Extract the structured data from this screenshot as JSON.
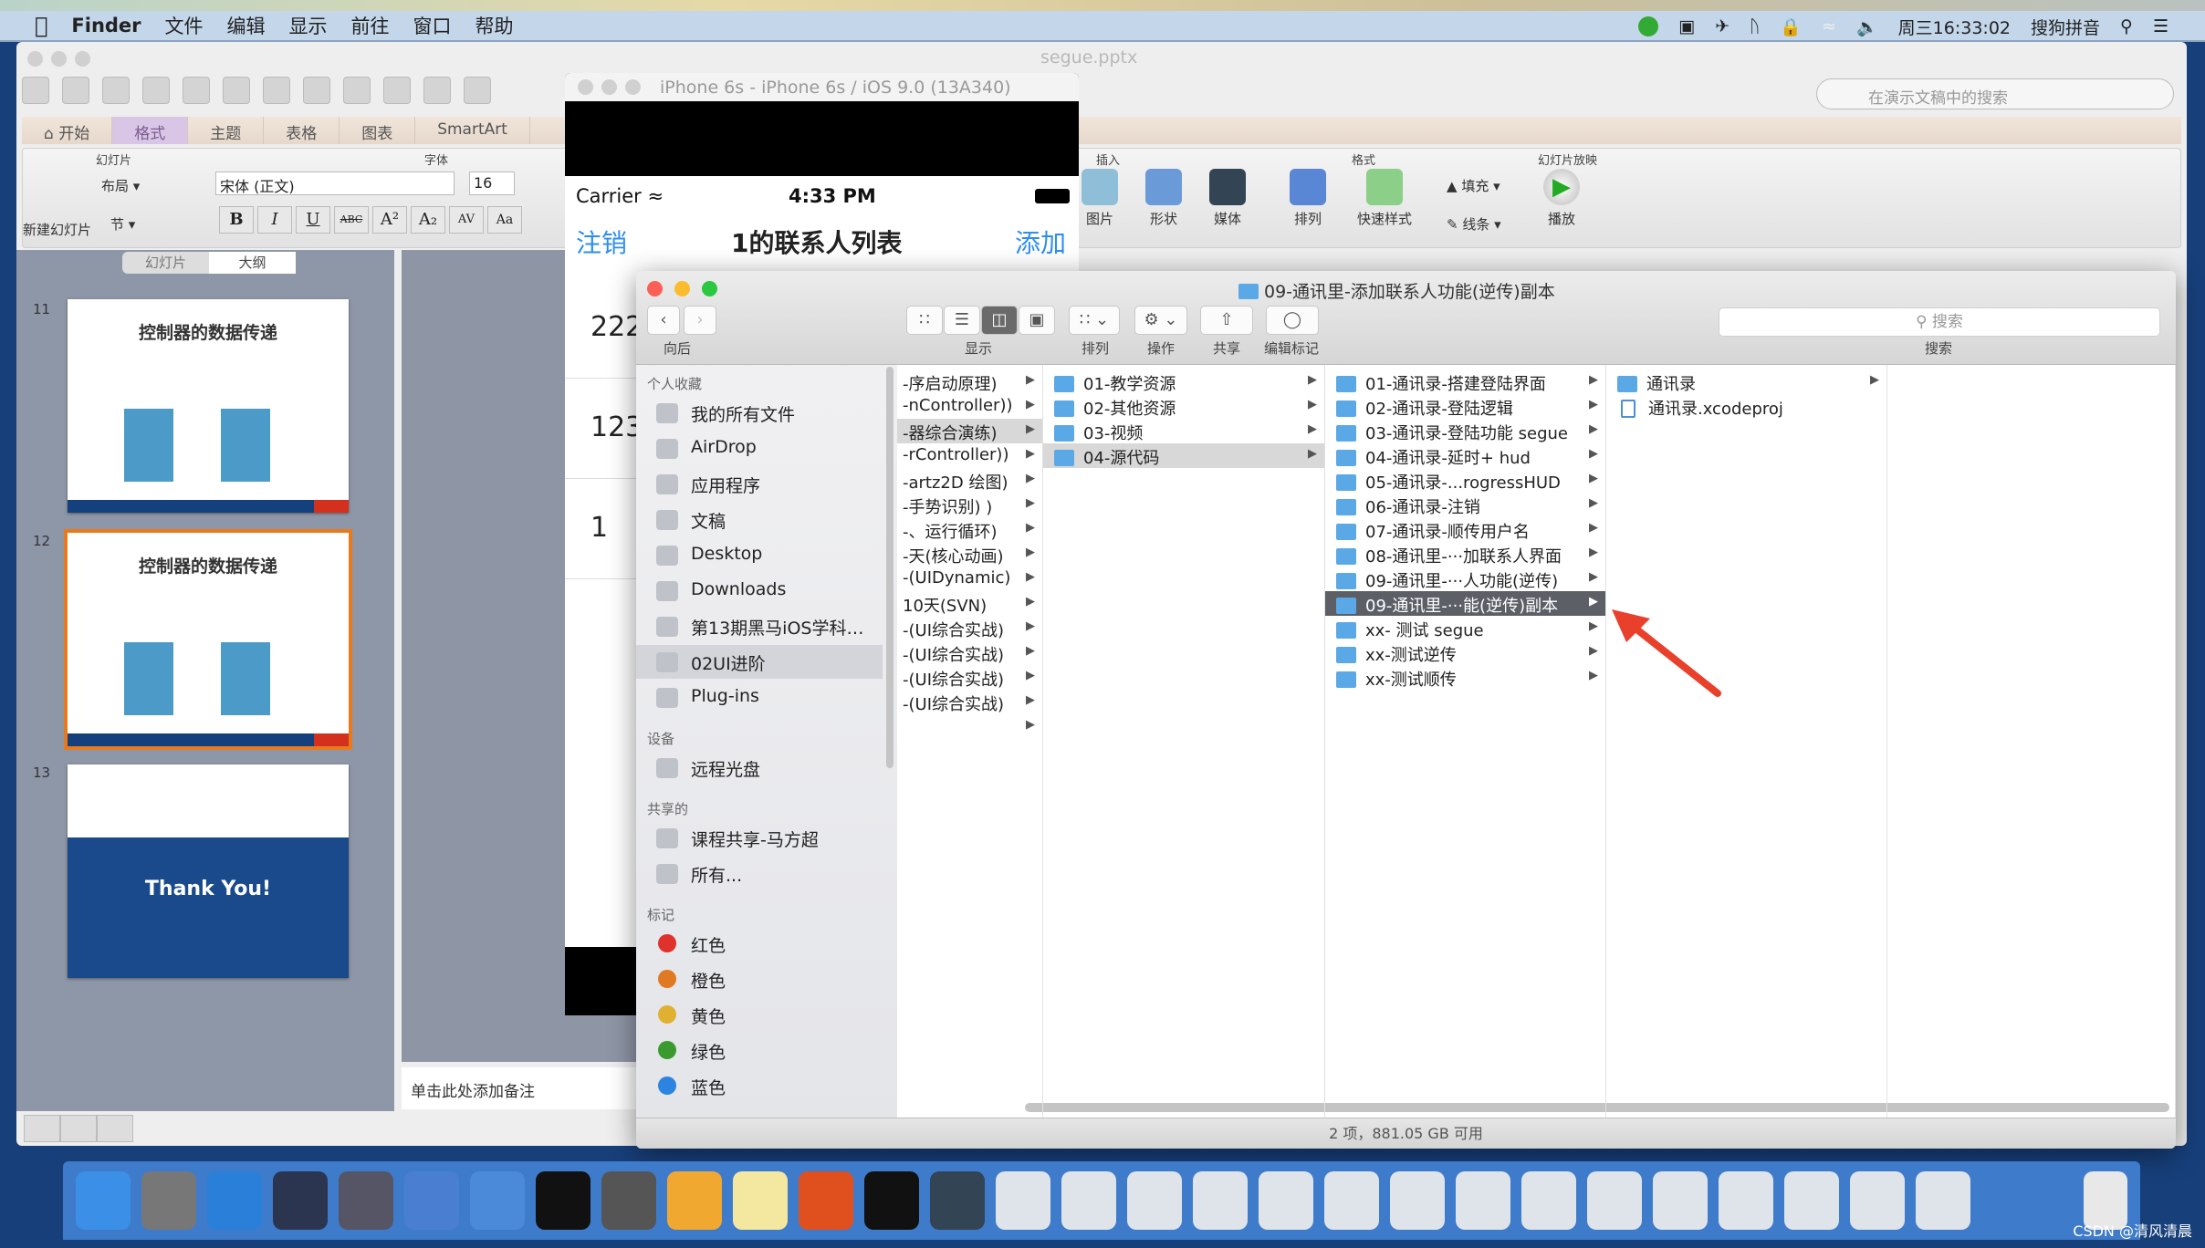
{
  "menubar": {
    "app": "Finder",
    "items": [
      "文件",
      "编辑",
      "显示",
      "前往",
      "窗口",
      "帮助"
    ],
    "clock": "周三16:33:02",
    "input_method": "搜狗拼音"
  },
  "ppt": {
    "title": "segue.pptx",
    "search_placeholder": "在演示文稿中的搜索",
    "tabs": [
      "开始",
      "格式",
      "主题",
      "表格",
      "图表",
      "SmartArt"
    ],
    "active_tab": "格式",
    "groups": {
      "slides": "幻灯片",
      "font": "字体",
      "insert": "插入",
      "format": "格式",
      "slideshow": "幻灯片放映"
    },
    "buttons": {
      "new_slide": "新建幻灯片",
      "layout": "布局",
      "section": "节",
      "picture": "图片",
      "shape": "形状",
      "media": "媒体",
      "arrange": "排列",
      "quick_style": "快速样式",
      "fill": "填充",
      "line": "线条",
      "play": "播放"
    },
    "font_name": "宋体 (正文)",
    "font_size": "16",
    "format_buttons": [
      "B",
      "I",
      "U",
      "ABC",
      "A²",
      "A₂",
      "AV",
      "Aa"
    ],
    "panel_tabs": [
      "幻灯片",
      "大纲"
    ],
    "slides": [
      {
        "num": "11",
        "title": "控制器的数据传递"
      },
      {
        "num": "12",
        "title": "控制器的数据传递",
        "selected": true
      },
      {
        "num": "13",
        "title": "Thank You!"
      }
    ],
    "notes_placeholder": "单击此处添加备注"
  },
  "simulator": {
    "title": "iPhone 6s - iPhone 6s / iOS 9.0 (13A340)",
    "carrier": "Carrier",
    "time": "4:33 PM",
    "nav_left": "注销",
    "nav_title": "1的联系人列表",
    "nav_right": "添加",
    "rows": [
      "222",
      "123",
      "1"
    ]
  },
  "finder": {
    "title": "09-通讯里-添加联系人功能(逆传)副本",
    "toolbar": {
      "back": "向后",
      "view": "显示",
      "arrange": "排列",
      "action": "操作",
      "share": "共享",
      "tags": "编辑标记",
      "search": "搜索",
      "search_placeholder": "搜索"
    },
    "sidebar": [
      {
        "heading": "个人收藏",
        "items": [
          "我的所有文件",
          "AirDrop",
          "应用程序",
          "文稿",
          "Desktop",
          "Downloads",
          "第13期黑马iOS学科…",
          "02UI进阶",
          "Plug-ins"
        ],
        "selected": "02UI进阶"
      },
      {
        "heading": "设备",
        "items": [
          "远程光盘"
        ]
      },
      {
        "heading": "共享的",
        "items": [
          "课程共享-马方超",
          "所有..."
        ]
      },
      {
        "heading": "标记",
        "items": [
          "红色",
          "橙色",
          "黄色",
          "绿色",
          "蓝色"
        ],
        "colors": [
          "#e0322c",
          "#e07a22",
          "#e0b030",
          "#3a9a2e",
          "#2c84e0"
        ]
      }
    ],
    "columns": [
      {
        "items": [
          "-序启动原理)",
          "-nController))",
          "-器综合演练)",
          "-rController))",
          "-artz2D 绘图)",
          "-手势识别) )",
          "-、运行循环)",
          "-天(核心动画)",
          "-(UIDynamic)",
          "10天(SVN)",
          "-(UI综合实战)",
          "-(UI综合实战)",
          "-(UI综合实战)",
          "-(UI综合实战)",
          ""
        ],
        "highlight": 2
      },
      {
        "items": [
          "01-教学资源",
          "02-其他资源",
          "03-视频",
          "04-源代码"
        ],
        "highlight": 3
      },
      {
        "items": [
          "01-通讯录-搭建登陆界面",
          "02-通讯录-登陆逻辑",
          "03-通讯录-登陆功能 segue",
          "04-通讯录-延时+ hud",
          "05-通讯录-...rogressHUD",
          "06-通讯录-注销",
          "07-通讯录-顺传用户名",
          "08-通讯里-···加联系人界面",
          "09-通讯里-···人功能(逆传)",
          "09-通讯里-···能(逆传)副本",
          "xx- 测试 segue",
          "xx-测试逆传",
          "xx-测试顺传"
        ],
        "selected": 9
      },
      {
        "items": [
          "通讯录",
          "通讯录.xcodeproj"
        ]
      }
    ],
    "status": "2 项，881.05 GB 可用"
  },
  "annotation_color": "#e8402a",
  "dock": {
    "apps": [
      "finder-icon",
      "launchpad-icon",
      "safari-icon",
      "mouse-icon",
      "photo-icon",
      "xcode-icon",
      "instruments-icon",
      "terminal-icon",
      "system-preferences-icon",
      "sketch-icon",
      "notes-icon",
      "powerpoint-icon",
      "console-icon",
      "quicktime-icon"
    ],
    "window_count": 15,
    "trash": "trash-icon"
  },
  "watermark": "CSDN @清风清晨"
}
